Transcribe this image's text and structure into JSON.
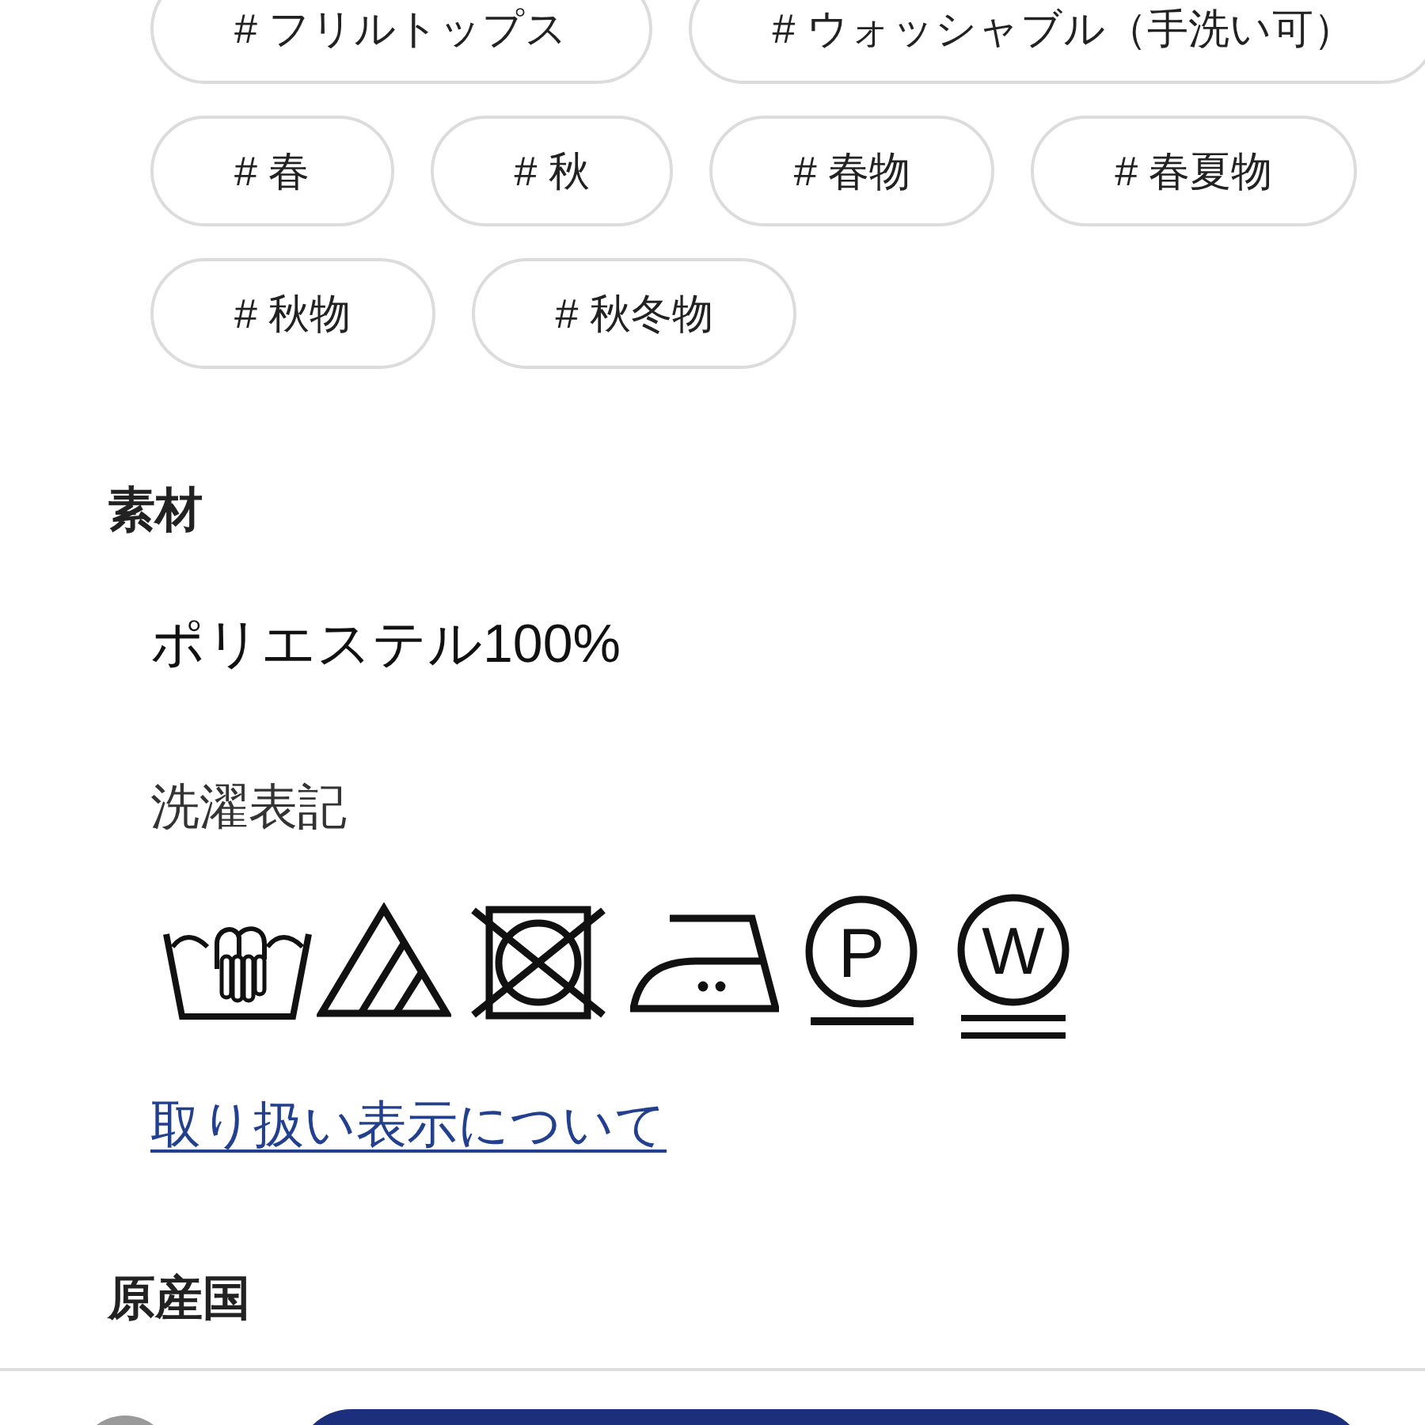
{
  "tags": [
    "# フリルトップス",
    "# ウォッシャブル（手洗い可）",
    "# 春",
    "# 秋",
    "# 春物",
    "# 春夏物",
    "# 秋物",
    "# 秋冬物"
  ],
  "material": {
    "heading": "素材",
    "value": "ポリエステル100%",
    "care_heading": "洗濯表記",
    "care_symbols": [
      {
        "kind": "hand_wash"
      },
      {
        "kind": "bleach"
      },
      {
        "kind": "no_tumble_dry"
      },
      {
        "kind": "iron"
      },
      {
        "kind": "dry_clean",
        "letter": "P"
      },
      {
        "kind": "wet_clean",
        "letter": "W"
      }
    ],
    "care_link": "取り扱い表示について"
  },
  "origin": {
    "heading": "原産国"
  }
}
